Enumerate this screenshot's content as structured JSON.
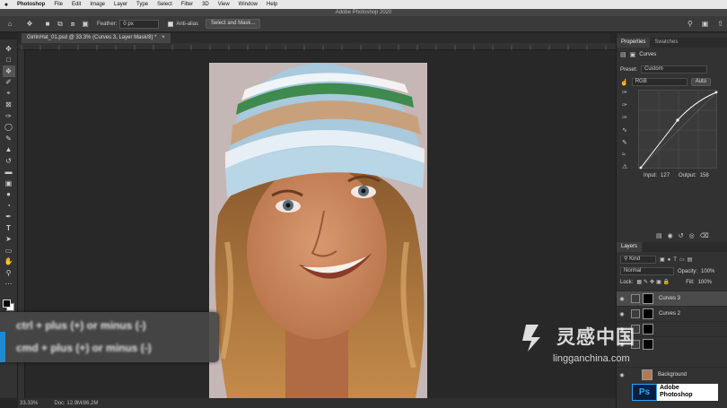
{
  "menubar": {
    "apple": "",
    "items": [
      "Photoshop",
      "File",
      "Edit",
      "Image",
      "Layer",
      "Type",
      "Select",
      "Filter",
      "3D",
      "View",
      "Window",
      "Help"
    ],
    "window_title": "Adobe Photoshop 2020"
  },
  "options": {
    "feather_label": "Feather:",
    "feather_value": "0 px",
    "antialias_label": "Anti-alias",
    "select_mask_label": "Select and Mask..."
  },
  "document": {
    "tab_label": "GirlInHat_01.psd @ 33.3% (Curves 3, Layer Mask/8) *"
  },
  "status": {
    "zoom": "33.33%",
    "doc": "Doc: 12.9M/86.2M"
  },
  "caption": {
    "line1": "ctrl + plus (+) or minus (-)",
    "line2": "cmd + plus (+) or minus (-)"
  },
  "properties": {
    "tabs": [
      "Properties",
      "Swatches"
    ],
    "panel_title": "Curves",
    "preset_label": "Preset:",
    "preset_value": "Custom",
    "channel_value": "RGB",
    "auto_label": "Auto",
    "input_label": "Input:",
    "input_value": "127",
    "output_label": "Output:",
    "output_value": "158"
  },
  "layers": {
    "tab_label": "Layers",
    "kind_label": "Kind",
    "blend_mode": "Normal",
    "opacity_label": "Opacity:",
    "opacity_value": "100%",
    "lock_label": "Lock:",
    "fill_label": "Fill:",
    "fill_value": "100%",
    "items": [
      {
        "name": "Curves 3",
        "selected": true
      },
      {
        "name": "Curves 2",
        "selected": false
      },
      {
        "name": "",
        "selected": false
      },
      {
        "name": "",
        "selected": false
      },
      {
        "name": "Background",
        "selected": false
      }
    ]
  },
  "watermark": {
    "cn": "灵感中国",
    "url": "lingganchina.com"
  },
  "ps_logo": {
    "badge": "Ps",
    "line1": "Adobe",
    "line2": "Photoshop"
  },
  "colors": {
    "accent": "#1d8bd3",
    "panel_bg": "#323232",
    "canvas_bg": "#282828"
  }
}
